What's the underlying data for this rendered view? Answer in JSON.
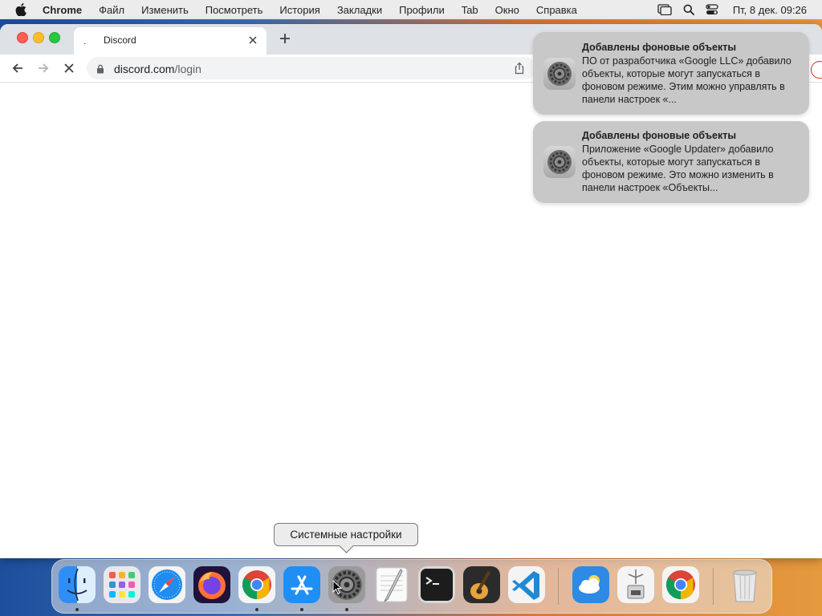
{
  "menubar": {
    "app_name": "Chrome",
    "items": [
      "Файл",
      "Изменить",
      "Посмотреть",
      "История",
      "Закладки",
      "Профили",
      "Tab",
      "Окно",
      "Справка"
    ],
    "clock": "Пт, 8 дек.  09:26"
  },
  "browser": {
    "tab": {
      "indicator": ".",
      "title": "Discord"
    },
    "url_host": "discord.com",
    "url_path": "/login"
  },
  "notifications": [
    {
      "title": "Добавлены фоновые объекты",
      "body": "ПО от разработчика «Google LLC» добавило объекты, которые могут запускаться в фоновом режиме. Этим можно управлять в панели настроек «..."
    },
    {
      "title": "Добавлены фоновые объекты",
      "body": "Приложение «Google Updater» добавило объекты, которые могут запускаться в фоновом режиме. Это можно изменить в панели настроек «Объекты..."
    }
  ],
  "tooltip": "Системные настройки",
  "dock": {
    "apps": [
      "finder",
      "launchpad",
      "safari",
      "firefox",
      "chrome",
      "app-store",
      "system-settings",
      "textedit",
      "terminal",
      "garageband",
      "vscode",
      "weather",
      "archive-utility",
      "chrome-app",
      "trash"
    ]
  }
}
